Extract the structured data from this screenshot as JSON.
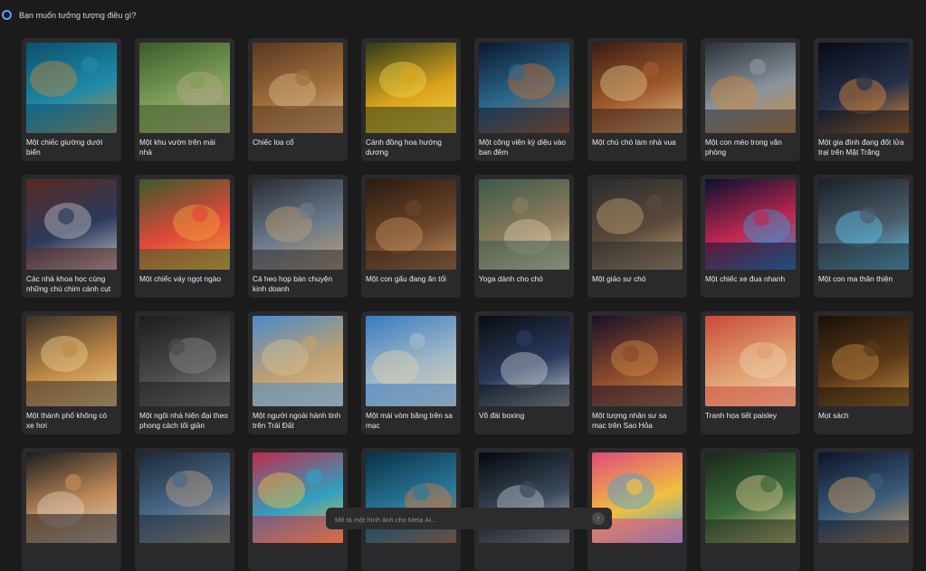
{
  "header": {
    "prompt": "Bạn muốn tưởng tượng điều gì?"
  },
  "input": {
    "placeholder": "Mô tả một hình ảnh cho Meta AI..."
  },
  "cards": [
    {
      "caption": "Một chiếc giường dưới biển",
      "colors": [
        "#0d4f6b",
        "#1e8aa8",
        "#c48a3a"
      ]
    },
    {
      "caption": "Một khu vườn trên mái nhà",
      "colors": [
        "#3c5a2a",
        "#7fa05a",
        "#b9a78a"
      ]
    },
    {
      "caption": "Chiếc loa cổ",
      "colors": [
        "#5a3620",
        "#a0703c",
        "#d9b78c"
      ]
    },
    {
      "caption": "Cánh đồng hoa hướng dương",
      "colors": [
        "#2c3a1a",
        "#d9a21c",
        "#f4d24a"
      ]
    },
    {
      "caption": "Một công viên kỳ diệu vào ban đêm",
      "colors": [
        "#0c1730",
        "#2c6a8c",
        "#d06a2a"
      ]
    },
    {
      "caption": "Một chú chó làm nhà vua",
      "colors": [
        "#3a1c14",
        "#a05a2c",
        "#e0c48a"
      ]
    },
    {
      "caption": "Một con mèo trong văn phòng",
      "colors": [
        "#2a3038",
        "#8a949c",
        "#d08a3c"
      ]
    },
    {
      "caption": "Một gia đình đang đốt lửa trại trên Mặt Trăng",
      "colors": [
        "#070b18",
        "#253048",
        "#e08a3a"
      ]
    },
    {
      "caption": "Các nhà khoa học cùng những chú chim cánh cụt",
      "colors": [
        "#5a2a20",
        "#2c3a5c",
        "#c0c0c4"
      ]
    },
    {
      "caption": "Một chiếc váy ngọt ngào",
      "colors": [
        "#3a5a2a",
        "#e0483a",
        "#f0a43c"
      ]
    },
    {
      "caption": "Cá heo họp bàn chuyện kinh doanh",
      "colors": [
        "#2a2c34",
        "#6a7a8c",
        "#c0a070"
      ]
    },
    {
      "caption": "Một con gấu đang ăn tối",
      "colors": [
        "#2a1a10",
        "#6a4428",
        "#c09060"
      ]
    },
    {
      "caption": "Yoga dành cho chó",
      "colors": [
        "#3c5a48",
        "#8a7a5c",
        "#d8c8a8"
      ]
    },
    {
      "caption": "Một giáo sư chó",
      "colors": [
        "#2a2c2e",
        "#5a4a3a",
        "#c0a070"
      ]
    },
    {
      "caption": "Một chiếc xe đua nhanh",
      "colors": [
        "#0a1030",
        "#c02850",
        "#30a0e0"
      ]
    },
    {
      "caption": "Một con ma thân thiện",
      "colors": [
        "#1a2028",
        "#4a5c6a",
        "#60c8f0"
      ]
    },
    {
      "caption": "Một thành phố không có xe hơi",
      "colors": [
        "#3a3028",
        "#c08a48",
        "#f0d090"
      ]
    },
    {
      "caption": "Một ngôi nhà hiện đại theo phong cách tối giản",
      "colors": [
        "#1c1c1e",
        "#4a4a4c",
        "#8a8a8c"
      ]
    },
    {
      "caption": "Một người ngoài hành tinh trên Trái Đất",
      "colors": [
        "#4a8ac8",
        "#c0a070",
        "#d8c098"
      ]
    },
    {
      "caption": "Một mái vòm băng trên sa mạc",
      "colors": [
        "#3a7ac0",
        "#a0b8c8",
        "#e0d0b0"
      ]
    },
    {
      "caption": "Võ đài boxing",
      "colors": [
        "#0a0c10",
        "#2a3a5c",
        "#c0c8d0"
      ]
    },
    {
      "caption": "Một tượng nhân sư sa mạc trên Sao Hỏa",
      "colors": [
        "#1a1028",
        "#8a4a2c",
        "#d08a48"
      ]
    },
    {
      "caption": "Tranh họa tiết paisley",
      "colors": [
        "#c84a3a",
        "#e0a070",
        "#f0d0b0"
      ]
    },
    {
      "caption": "Mọt sách",
      "colors": [
        "#1a1008",
        "#5a3818",
        "#c08a40"
      ]
    },
    {
      "caption": "",
      "colors": [
        "#1c1c1e",
        "#c08a5a",
        "#e0d0c0"
      ]
    },
    {
      "caption": "",
      "colors": [
        "#1c2838",
        "#4a6a8a",
        "#c0a080"
      ]
    },
    {
      "caption": "",
      "colors": [
        "#c02a4a",
        "#30a0c0",
        "#f0c040"
      ]
    },
    {
      "caption": "",
      "colors": [
        "#0a3048",
        "#2a7a9a",
        "#e0783a"
      ]
    },
    {
      "caption": "",
      "colors": [
        "#05070c",
        "#3a4a5c",
        "#c0c4c8"
      ]
    },
    {
      "caption": "",
      "colors": [
        "#e04a7a",
        "#f0c040",
        "#40a0e0"
      ]
    },
    {
      "caption": "",
      "colors": [
        "#1a2818",
        "#3a6a3a",
        "#e0c890"
      ]
    },
    {
      "caption": "",
      "colors": [
        "#0c1428",
        "#3a5a7a",
        "#d0a060"
      ]
    }
  ]
}
